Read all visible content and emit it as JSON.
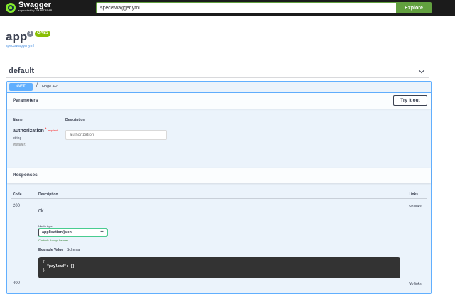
{
  "topbar": {
    "logo_title": "Swagger",
    "logo_sub": "supported by SMARTBEAR",
    "url_value": "spec/swagger.yml",
    "explore_label": "Explore"
  },
  "info": {
    "title": "app",
    "version": "1",
    "oas": "OAS3",
    "spec_link": "spec/swagger.yml"
  },
  "tag": {
    "name": "default"
  },
  "operation": {
    "method": "GET",
    "path": "/",
    "summary": "Hoge API",
    "parameters_title": "Parameters",
    "try_label": "Try it out",
    "param_columns": {
      "name": "Name",
      "description": "Description"
    },
    "parameter": {
      "name": "authorization",
      "required_star": "*",
      "required_label": "required",
      "type": "string",
      "in": "(header)",
      "placeholder": "authorization"
    },
    "responses_title": "Responses",
    "resp_columns": {
      "code": "Code",
      "description": "Description",
      "links": "Links"
    },
    "responses": [
      {
        "code": "200",
        "description": "ok",
        "links": "No links",
        "media_type_label": "Media type",
        "media_type": "application/json",
        "accept_note": "Controls Accept header.",
        "example_tab": "Example Value",
        "schema_tab": "Schema",
        "example_lines": [
          "{",
          "  \"payload\": {}",
          "}"
        ]
      },
      {
        "code": "400",
        "links": "No links"
      }
    ]
  },
  "colors": {
    "get": "#61affe",
    "explore": "#62a03f",
    "oas": "#89bf04"
  }
}
